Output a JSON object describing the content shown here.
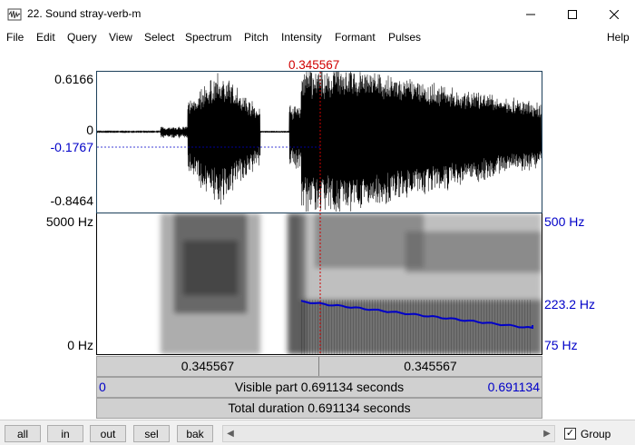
{
  "window": {
    "title": "22. Sound stray-verb-m",
    "icons": {
      "app": "praat-icon",
      "minimize": "minimize-icon",
      "maximize": "maximize-icon",
      "close": "close-icon"
    }
  },
  "menu": {
    "items": [
      "File",
      "Edit",
      "Query",
      "View",
      "Select",
      "Spectrum",
      "Pitch",
      "Intensity",
      "Formant",
      "Pulses"
    ],
    "help": "Help"
  },
  "editor": {
    "cursor_time": "0.345567",
    "waveform": {
      "y_max": "0.6166",
      "y_zero": "0",
      "y_cursor": "-0.1767",
      "y_min": "-0.8464"
    },
    "spectrogram": {
      "freq_top": "5000 Hz",
      "freq_bottom": "0 Hz",
      "pitch_top": "500 Hz",
      "pitch_cursor": "223.2 Hz",
      "pitch_bottom": "75 Hz"
    },
    "bars": {
      "left_segment": "0.345567",
      "right_segment": "0.345567",
      "visible_start": "0",
      "visible_label": "Visible part 0.691134 seconds",
      "visible_end": "0.691134",
      "total_label": "Total duration 0.691134 seconds"
    },
    "colors": {
      "cursor": "#d00000",
      "pitch": "#0000c8",
      "frame": "#1c3f5a"
    }
  },
  "toolbar": {
    "buttons": [
      "all",
      "in",
      "out",
      "sel",
      "bak"
    ],
    "group_label": "Group",
    "group_checked": true,
    "check_mark": "✓"
  }
}
